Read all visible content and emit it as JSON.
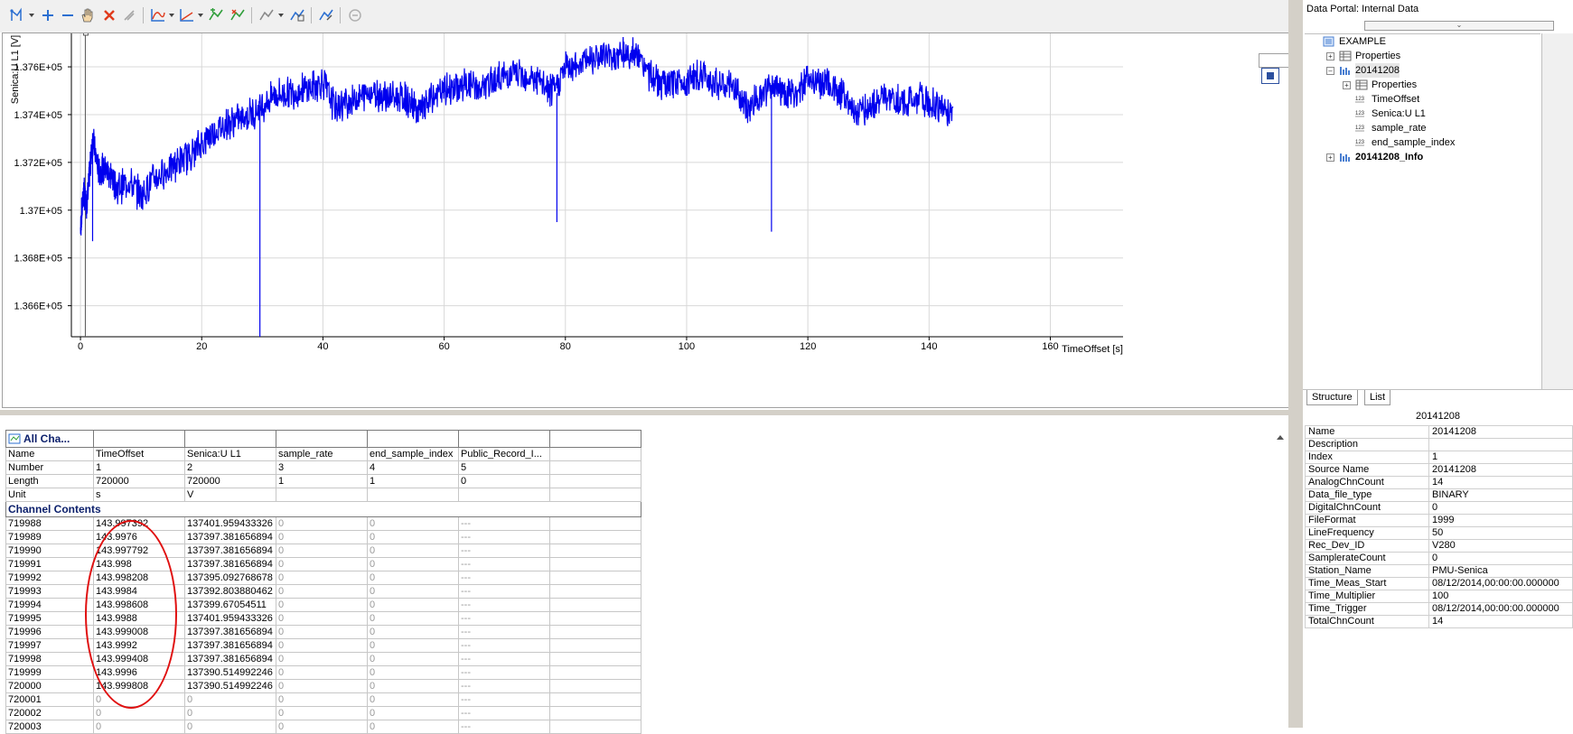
{
  "toolbar": {
    "icons": [
      "cursor-mode-icon",
      "zoom-in-icon",
      "zoom-out-icon",
      "pan-hand-icon",
      "delete-icon",
      "clear-icon",
      "curve-icon",
      "axis-icon",
      "move-curve-icon",
      "cursor-swap-icon",
      "band-icon",
      "annotation-icon",
      "format-icon",
      "undo-icon"
    ]
  },
  "chart_data": {
    "type": "line",
    "title": "",
    "xlabel": "TimeOffset [s]",
    "ylabel": "Senica:U L1 [V]",
    "xlim": [
      -1.5,
      172
    ],
    "ylim": [
      136470,
      137740
    ],
    "xticks": [
      0,
      20,
      40,
      60,
      80,
      100,
      120,
      140,
      160
    ],
    "xtick_labels": [
      "0",
      "20",
      "40",
      "60",
      "80",
      "100",
      "120",
      "140",
      "160"
    ],
    "yticks": [
      136600,
      136800,
      137000,
      137200,
      137400,
      137600
    ],
    "ytick_labels": [
      "1.366E+05",
      "1.368E+05",
      "1.37E+05",
      "1.372E+05",
      "1.374E+05",
      "1.376E+05"
    ],
    "grid": true,
    "color": "#0000ee",
    "series": [
      {
        "x": [
          0,
          0.5,
          1,
          1.5,
          2,
          3,
          4,
          5,
          6,
          8,
          10,
          12,
          14,
          16,
          18,
          20,
          22,
          24,
          26,
          28,
          30,
          32,
          34,
          36,
          38,
          40,
          42,
          44,
          46,
          48,
          50,
          52,
          54,
          56,
          58,
          60,
          62,
          64,
          66,
          68,
          70,
          72,
          74,
          76,
          78,
          80,
          82,
          84,
          86,
          88,
          90,
          92,
          94,
          96,
          98,
          100,
          102,
          104,
          106,
          108,
          110,
          112,
          114,
          116,
          118,
          120,
          122,
          124,
          126,
          128,
          130,
          132,
          134,
          136,
          138,
          140,
          142,
          144
        ],
        "y": [
          136920,
          137080,
          137020,
          137150,
          137300,
          137160,
          137170,
          137150,
          137090,
          137120,
          137060,
          137130,
          137160,
          137200,
          137230,
          137280,
          137330,
          137360,
          137380,
          137400,
          137440,
          137480,
          137490,
          137500,
          137510,
          137540,
          137430,
          137450,
          137470,
          137500,
          137480,
          137470,
          137460,
          137410,
          137470,
          137500,
          137510,
          137530,
          137500,
          137540,
          137560,
          137570,
          137560,
          137530,
          137490,
          137600,
          137610,
          137640,
          137650,
          137640,
          137660,
          137640,
          137560,
          137520,
          137530,
          137540,
          137560,
          137550,
          137520,
          137510,
          137420,
          137480,
          137510,
          137500,
          137480,
          137560,
          137530,
          137520,
          137480,
          137410,
          137430,
          137470,
          137460,
          137450,
          137470,
          137450,
          137430,
          137410
        ],
        "spikes": [
          [
            29.6,
            136470
          ],
          [
            78.6,
            136950
          ],
          [
            114,
            136910
          ],
          [
            2,
            136870
          ]
        ]
      }
    ]
  },
  "table": {
    "all_channels_label": "All Cha...",
    "headers": [
      "Name",
      "TimeOffset",
      "Senica:U L1",
      "sample_rate",
      "end_sample_index",
      "Public_Record_I...",
      ""
    ],
    "meta_rows": [
      [
        "Number",
        "1",
        "2",
        "3",
        "4",
        "5",
        ""
      ],
      [
        "Length",
        "720000",
        "720000",
        "1",
        "1",
        "0",
        ""
      ],
      [
        "Unit",
        "s",
        "V",
        "",
        "",
        "",
        ""
      ]
    ],
    "section_label": "Channel Contents",
    "rows": [
      [
        "719988",
        "143.997392",
        "137401.959433326",
        "0",
        "0",
        "---"
      ],
      [
        "719989",
        "143.9976",
        "137397.381656894",
        "0",
        "0",
        "---"
      ],
      [
        "719990",
        "143.997792",
        "137397.381656894",
        "0",
        "0",
        "---"
      ],
      [
        "719991",
        "143.998",
        "137397.381656894",
        "0",
        "0",
        "---"
      ],
      [
        "719992",
        "143.998208",
        "137395.092768678",
        "0",
        "0",
        "---"
      ],
      [
        "719993",
        "143.9984",
        "137392.803880462",
        "0",
        "0",
        "---"
      ],
      [
        "719994",
        "143.998608",
        "137399.67054511",
        "0",
        "0",
        "---"
      ],
      [
        "719995",
        "143.9988",
        "137401.959433326",
        "0",
        "0",
        "---"
      ],
      [
        "719996",
        "143.999008",
        "137397.381656894",
        "0",
        "0",
        "---"
      ],
      [
        "719997",
        "143.9992",
        "137397.381656894",
        "0",
        "0",
        "---"
      ],
      [
        "719998",
        "143.999408",
        "137397.381656894",
        "0",
        "0",
        "---"
      ],
      [
        "719999",
        "143.9996",
        "137390.514992246",
        "0",
        "0",
        "---"
      ],
      [
        "720000",
        "143.999808",
        "137390.514992246",
        "0",
        "0",
        "---"
      ],
      [
        "720001",
        "0",
        "0",
        "0",
        "0",
        "---"
      ],
      [
        "720002",
        "0",
        "0",
        "0",
        "0",
        "---"
      ],
      [
        "720003",
        "0",
        "0",
        "0",
        "0",
        "---"
      ]
    ]
  },
  "portal": {
    "title": "Data Portal: Internal Data",
    "tree": [
      {
        "label": "EXAMPLE",
        "indent": 0,
        "expander": "",
        "icon": "file-icon",
        "bold": false,
        "selected": false
      },
      {
        "label": "Properties",
        "indent": 1,
        "expander": "+",
        "icon": "properties-icon",
        "bold": false,
        "selected": false
      },
      {
        "label": "20141208",
        "indent": 1,
        "expander": "-",
        "icon": "group-icon",
        "bold": false,
        "selected": true
      },
      {
        "label": "Properties",
        "indent": 2,
        "expander": "+",
        "icon": "properties-icon",
        "bold": false,
        "selected": false
      },
      {
        "label": "TimeOffset",
        "indent": 2,
        "expander": "",
        "icon": "numeric-channel-icon",
        "bold": false,
        "selected": false
      },
      {
        "label": "Senica:U L1",
        "indent": 2,
        "expander": "",
        "icon": "numeric-channel-icon",
        "bold": false,
        "selected": false
      },
      {
        "label": "sample_rate",
        "indent": 2,
        "expander": "",
        "icon": "numeric-channel-icon",
        "bold": false,
        "selected": false
      },
      {
        "label": "end_sample_index",
        "indent": 2,
        "expander": "",
        "icon": "numeric-channel-icon",
        "bold": false,
        "selected": false
      },
      {
        "label": "20141208_Info",
        "indent": 1,
        "expander": "+",
        "icon": "group-icon",
        "bold": true,
        "selected": false
      }
    ],
    "tabs": [
      "Structure",
      "List"
    ],
    "props_title": "20141208",
    "props": [
      [
        "Name",
        "20141208"
      ],
      [
        "Description",
        ""
      ],
      [
        "Index",
        "1"
      ],
      [
        "Source Name",
        "20141208"
      ],
      [
        "AnalogChnCount",
        "14"
      ],
      [
        "Data_file_type",
        "BINARY"
      ],
      [
        "DigitalChnCount",
        "0"
      ],
      [
        "FileFormat",
        "1999"
      ],
      [
        "LineFrequency",
        "50"
      ],
      [
        "Rec_Dev_ID",
        "V280"
      ],
      [
        "SamplerateCount",
        "0"
      ],
      [
        "Station_Name",
        "PMU-Senica"
      ],
      [
        "Time_Meas_Start",
        "08/12/2014,00:00:00.000000"
      ],
      [
        "Time_Multiplier",
        "100"
      ],
      [
        "Time_Trigger",
        "08/12/2014,00:00:00.000000"
      ],
      [
        "TotalChnCount",
        "14"
      ]
    ]
  }
}
